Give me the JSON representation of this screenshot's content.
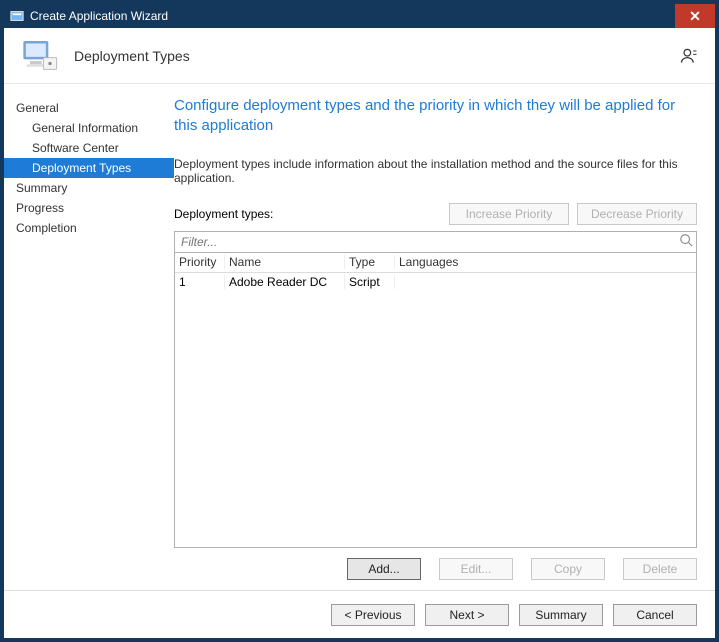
{
  "window": {
    "title": "Create Application Wizard"
  },
  "banner": {
    "title": "Deployment Types"
  },
  "sidebar": {
    "items": [
      {
        "label": "General",
        "indent": 0,
        "selected": false
      },
      {
        "label": "General Information",
        "indent": 1,
        "selected": false
      },
      {
        "label": "Software Center",
        "indent": 1,
        "selected": false
      },
      {
        "label": "Deployment Types",
        "indent": 1,
        "selected": true
      },
      {
        "label": "Summary",
        "indent": 0,
        "selected": false
      },
      {
        "label": "Progress",
        "indent": 0,
        "selected": false
      },
      {
        "label": "Completion",
        "indent": 0,
        "selected": false
      }
    ]
  },
  "main": {
    "heading": "Configure deployment types and the priority in which they will be applied for this application",
    "subtext": "Deployment types include information about the installation method and the source files for this application.",
    "dt_label": "Deployment types:",
    "inc_priority": "Increase Priority",
    "dec_priority": "Decrease Priority",
    "filter_placeholder": "Filter...",
    "columns": {
      "priority": "Priority",
      "name": "Name",
      "type": "Type",
      "lang": "Languages"
    },
    "rows": [
      {
        "priority": "1",
        "name": "Adobe Reader DC",
        "type": "Script",
        "lang": ""
      }
    ],
    "actions": {
      "add": "Add...",
      "edit": "Edit...",
      "copy": "Copy",
      "delete": "Delete"
    }
  },
  "footer": {
    "previous": "< Previous",
    "next": "Next >",
    "summary": "Summary",
    "cancel": "Cancel"
  }
}
